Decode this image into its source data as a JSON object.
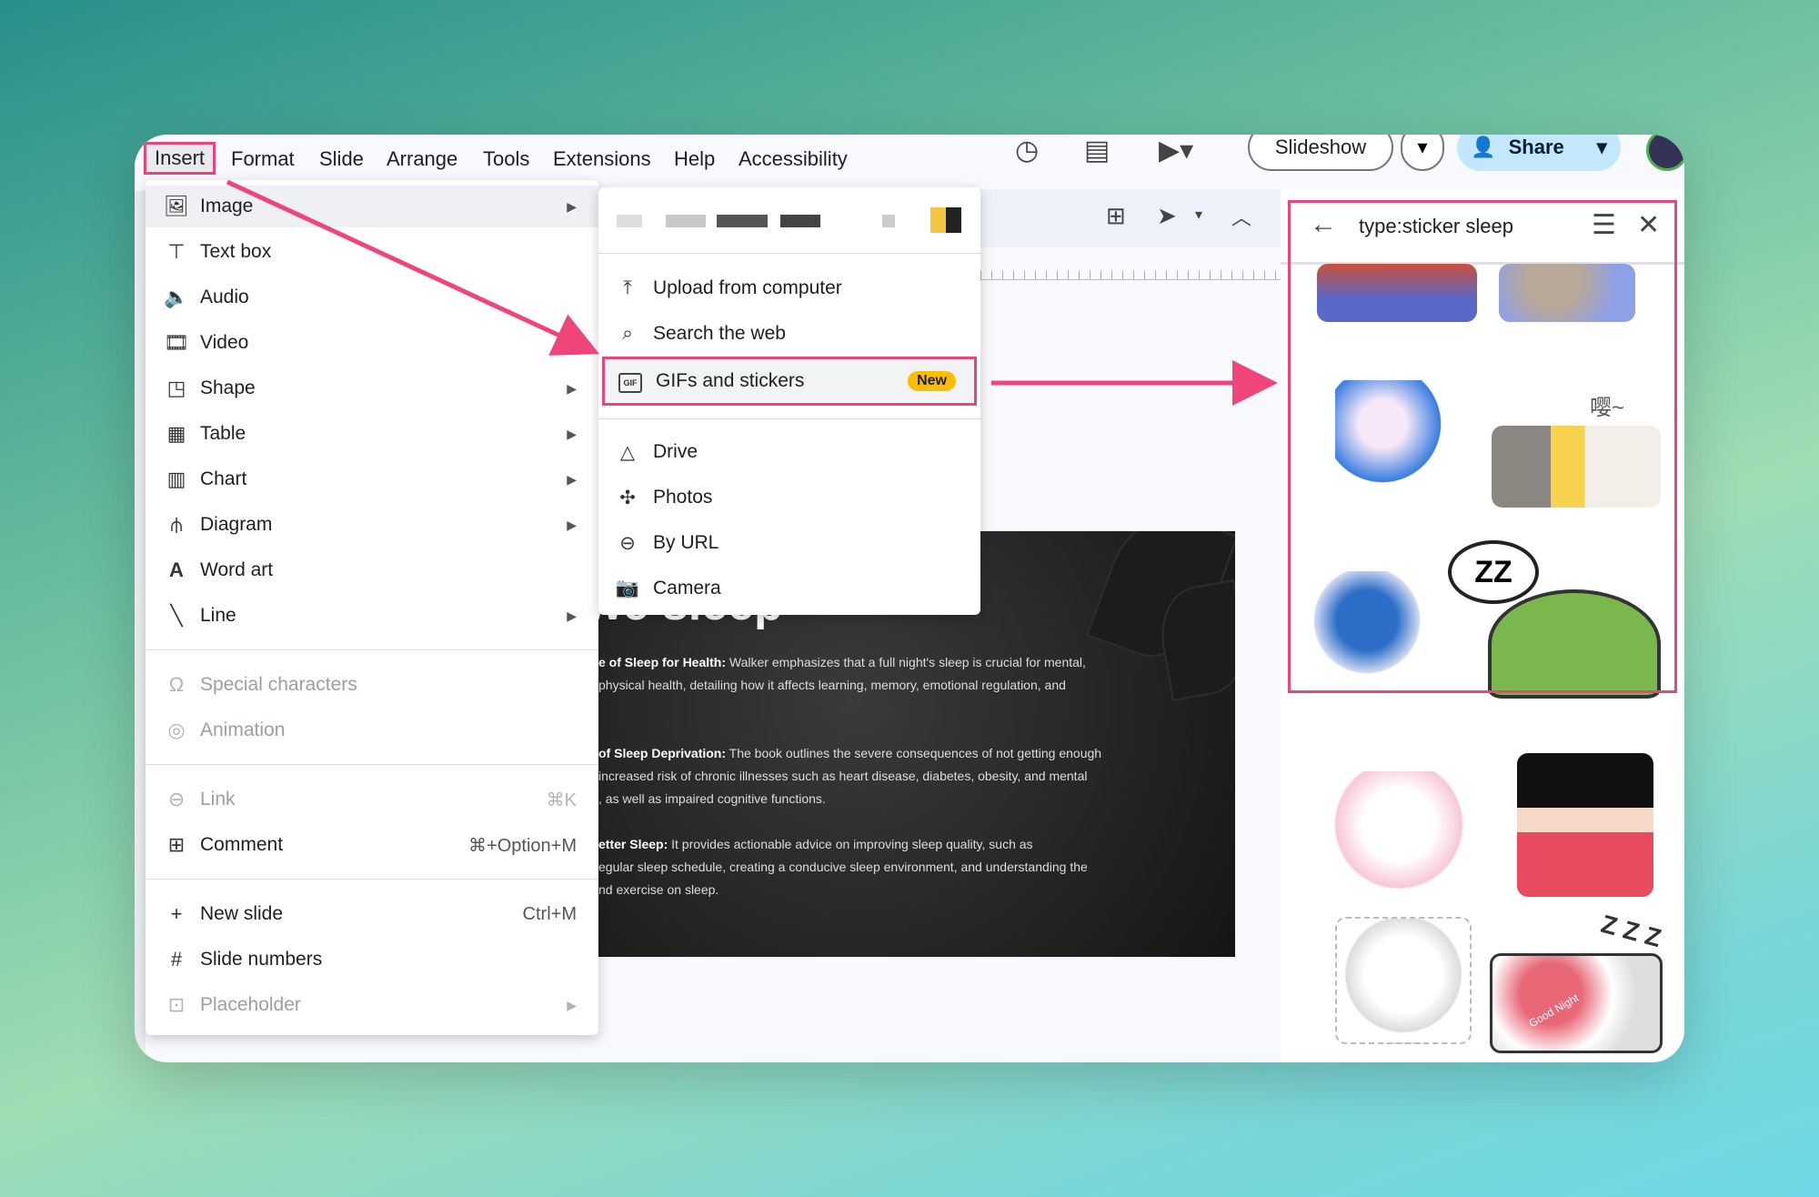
{
  "menubar": {
    "items": [
      "Insert",
      "Format",
      "Slide",
      "Arrange",
      "Tools",
      "Extensions",
      "Help",
      "Accessibility"
    ],
    "slideshow_label": "Slideshow",
    "share_label": "Share"
  },
  "insert_menu": {
    "items": [
      {
        "label": "Image",
        "icon": "image-icon"
      },
      {
        "label": "Text box",
        "icon": "text-box-icon"
      },
      {
        "label": "Audio",
        "icon": "audio-icon"
      },
      {
        "label": "Video",
        "icon": "video-icon"
      },
      {
        "label": "Shape",
        "icon": "shape-icon"
      },
      {
        "label": "Table",
        "icon": "table-icon"
      },
      {
        "label": "Chart",
        "icon": "chart-icon"
      },
      {
        "label": "Diagram",
        "icon": "diagram-icon"
      },
      {
        "label": "Word art",
        "icon": "word-art-icon"
      },
      {
        "label": "Line",
        "icon": "line-icon"
      },
      {
        "label": "Special characters",
        "icon": "omega-icon"
      },
      {
        "label": "Animation",
        "icon": "animation-icon"
      },
      {
        "label": "Link",
        "icon": "link-icon",
        "shortcut": "⌘K"
      },
      {
        "label": "Comment",
        "icon": "comment-icon",
        "shortcut": "⌘+Option+M"
      },
      {
        "label": "New slide",
        "icon": "plus-icon",
        "shortcut": "Ctrl+M"
      },
      {
        "label": "Slide numbers",
        "icon": "hash-icon"
      },
      {
        "label": "Placeholder",
        "icon": "placeholder-icon"
      }
    ]
  },
  "image_submenu": {
    "items": [
      {
        "label": "Upload from computer",
        "icon": "upload-icon"
      },
      {
        "label": "Search the web",
        "icon": "search-icon"
      },
      {
        "label": "GIFs and stickers",
        "icon": "gif-icon",
        "badge": "New",
        "gif_text": "GIF"
      },
      {
        "label": "Drive",
        "icon": "drive-icon"
      },
      {
        "label": "Photos",
        "icon": "photos-icon"
      },
      {
        "label": "By URL",
        "icon": "link-icon"
      },
      {
        "label": "Camera",
        "icon": "camera-icon"
      }
    ]
  },
  "slide": {
    "title_fragment": "we sleep",
    "paragraphs": [
      {
        "bold": "e of Sleep for Health:",
        "text": " Walker emphasizes that a full night's sleep is crucial for mental,",
        "line2": "physical health, detailing how it affects learning, memory, emotional regulation, and"
      },
      {
        "bold": "of Sleep Deprivation:",
        "text": " The book outlines the severe consequences of not getting enough",
        "line2": "increased risk of chronic illnesses such as heart disease, diabetes, obesity, and mental",
        "line3": ", as well as impaired cognitive functions."
      },
      {
        "bold": "etter Sleep:",
        "text": " It provides actionable advice on improving sleep quality, such as",
        "line2": "egular sleep schedule, creating a conducive sleep environment, and understanding the",
        "line3": "nd exercise on sleep."
      }
    ]
  },
  "sticker_panel": {
    "search_query": "type:sticker sleep",
    "sticker_text": {
      "zz": "ZZ",
      "zzz": "Z Z Z",
      "heh": "嘤~",
      "good_night": "Good Night"
    }
  },
  "colors": {
    "highlight": "#e8457a",
    "badge": "#fbbc04",
    "share_bg": "#c2e7ff"
  }
}
